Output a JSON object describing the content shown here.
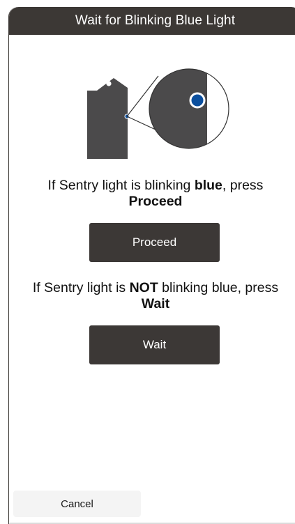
{
  "dialog": {
    "title": "Wait for Blinking Blue Light"
  },
  "illustration": {
    "device_color": "#4b4a4b",
    "light_color": "#0b4f9e"
  },
  "proceed_instruction": {
    "prefix": "If Sentry light is blinking ",
    "emphasis": "blue",
    "middle": ", press",
    "action": "Proceed"
  },
  "proceed_button": {
    "label": "Proceed"
  },
  "wait_instruction": {
    "prefix": "If Sentry light is ",
    "emphasis": "NOT",
    "middle": " blinking blue, press",
    "action": "Wait"
  },
  "wait_button": {
    "label": "Wait"
  },
  "cancel_button": {
    "label": "Cancel"
  },
  "colors": {
    "header_bg": "#3c3835",
    "button_bg": "#3c3836"
  }
}
